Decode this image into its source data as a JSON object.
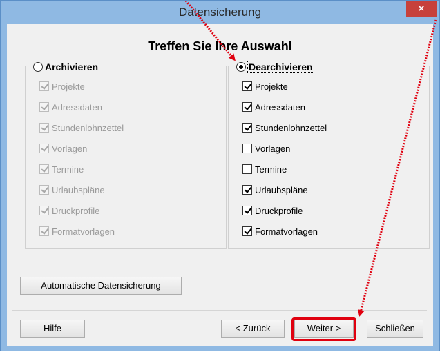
{
  "window": {
    "title": "Datensicherung",
    "close_glyph": "×"
  },
  "heading": "Treffen Sie Ihre Auswahl",
  "archive": {
    "label": "Archivieren",
    "selected": false,
    "items": [
      {
        "label": "Projekte",
        "checked": true
      },
      {
        "label": "Adressdaten",
        "checked": true
      },
      {
        "label": "Stundenlohnzettel",
        "checked": true
      },
      {
        "label": "Vorlagen",
        "checked": true
      },
      {
        "label": "Termine",
        "checked": true
      },
      {
        "label": "Urlaubspläne",
        "checked": true
      },
      {
        "label": "Druckprofile",
        "checked": true
      },
      {
        "label": "Formatvorlagen",
        "checked": true
      }
    ]
  },
  "dearchive": {
    "label": "Dearchivieren",
    "selected": true,
    "items": [
      {
        "label": "Projekte",
        "checked": true
      },
      {
        "label": "Adressdaten",
        "checked": true
      },
      {
        "label": "Stundenlohnzettel",
        "checked": true
      },
      {
        "label": "Vorlagen",
        "checked": false
      },
      {
        "label": "Termine",
        "checked": false
      },
      {
        "label": "Urlaubspläne",
        "checked": true
      },
      {
        "label": "Druckprofile",
        "checked": true
      },
      {
        "label": "Formatvorlagen",
        "checked": true
      }
    ]
  },
  "buttons": {
    "auto_backup": "Automatische Datensicherung",
    "help": "Hilfe",
    "back": "< Zurück",
    "next": "Weiter >",
    "close": "Schließen"
  },
  "colors": {
    "annotation": "#e0000f",
    "title_bar": "#8fb9e3",
    "close_button": "#c7413b"
  }
}
